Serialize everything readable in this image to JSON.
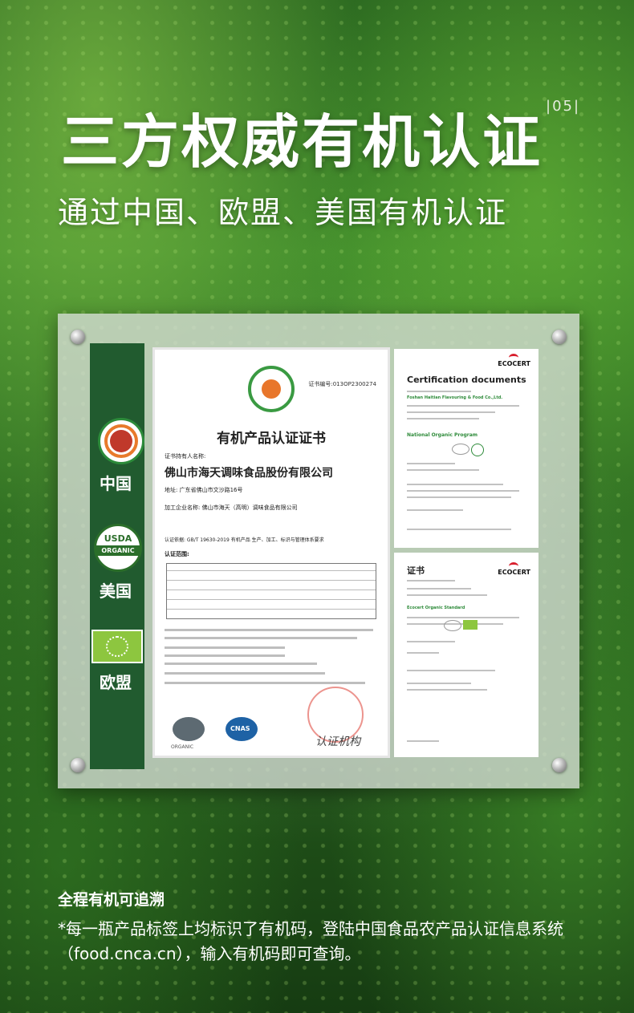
{
  "header": {
    "title": "三方权威有机认证",
    "page_number": "|05|",
    "subtitle": "通过中国、欧盟、美国有机认证"
  },
  "badges": {
    "china_label": "中国",
    "usa_label": "美国",
    "usda_top": "USDA",
    "usda_band": "ORGANIC",
    "eu_label": "欧盟"
  },
  "certificate_cn": {
    "number": "证书编号:013OP2300274",
    "heading": "有机产品认证证书",
    "holder_label": "证书持有人名称:",
    "holder": "佛山市海天调味食品股份有限公司",
    "address": "地址: 广东省佛山市文沙路16号",
    "processor": "加工企业名称: 佛山市海天（高明）调味食品有限公司",
    "standard": "认证依据: GB/T 19630-2019 有机产品 生产、加工、标识与管理体系要求",
    "scope_label": "认证范围:",
    "signature": "认证机构",
    "seal_text_1": "ORGANIC",
    "seal_text_2": "CNAS"
  },
  "certificate_us": {
    "brand": "ECOCERT",
    "title": "Certification documents",
    "company": "Foshan Haitian Flavouring & Food Co.,Ltd.",
    "program": "National Organic Program"
  },
  "certificate_eu": {
    "brand": "ECOCERT",
    "title": "证书",
    "program": "Ecocert Organic Standard"
  },
  "footer": {
    "heading": "全程有机可追溯",
    "text": "*每一瓶产品标签上均标识了有机码，登陆中国食品农产品认证信息系统（food.cnca.cn），输入有机码即可查询。"
  }
}
